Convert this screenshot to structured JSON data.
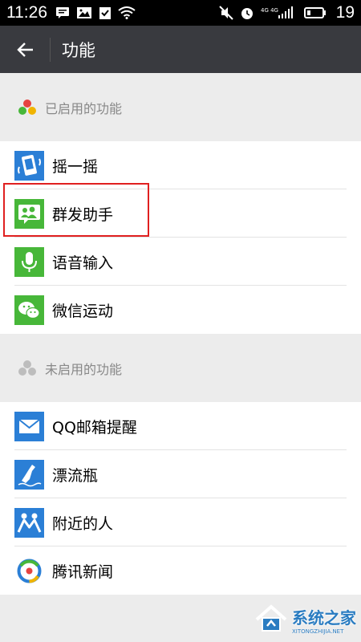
{
  "status_bar": {
    "time": "11:26",
    "network": "4G 4G",
    "battery": "19"
  },
  "toolbar": {
    "title": "功能"
  },
  "enabled_section": {
    "title": "已启用的功能",
    "items": [
      {
        "label": "摇一摇",
        "icon": "shake-icon",
        "color": "#2b7fd6"
      },
      {
        "label": "群发助手",
        "icon": "group-send-icon",
        "color": "#47b739"
      },
      {
        "label": "语音输入",
        "icon": "microphone-icon",
        "color": "#47b739"
      },
      {
        "label": "微信运动",
        "icon": "wechat-sport-icon",
        "color": "#47b739"
      }
    ]
  },
  "disabled_section": {
    "title": "未启用的功能",
    "items": [
      {
        "label": "QQ邮箱提醒",
        "icon": "mail-icon",
        "color": "#2b7fd6"
      },
      {
        "label": "漂流瓶",
        "icon": "bottle-icon",
        "color": "#2b7fd6"
      },
      {
        "label": "附近的人",
        "icon": "people-nearby-icon",
        "color": "#2b7fd6"
      },
      {
        "label": "腾讯新闻",
        "icon": "tencent-news-icon",
        "color": "#2b7fd6"
      }
    ]
  },
  "watermark": {
    "text": "系统之家",
    "subtext": "XITONGZHIJIA.NET"
  },
  "colors": {
    "toolbar": "#393a3f",
    "highlight": "#e02020",
    "green": "#47b739",
    "blue": "#2b7fd6"
  }
}
